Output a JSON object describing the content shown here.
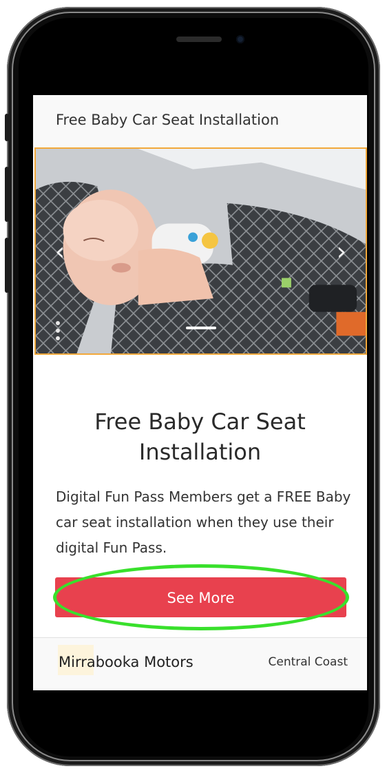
{
  "topbar": {
    "title": "Free Baby Car Seat Installation"
  },
  "carousel": {
    "prev_icon": "‹",
    "next_icon": "›",
    "image_subject": "sleeping-baby-in-car-seat"
  },
  "content": {
    "heading": "Free Baby Car Seat Installation",
    "description": "Digital Fun Pass Members get a FREE Baby car seat installation when they use their digital Fun Pass."
  },
  "cta": {
    "label": "See More"
  },
  "footer": {
    "brand_prefix": "Mirr",
    "brand_suffix": "abooka Motors",
    "location": "Central Coast"
  },
  "colors": {
    "accent": "#e8414e",
    "carousel_border": "#f2a83a",
    "annotation": "#39e02c"
  }
}
